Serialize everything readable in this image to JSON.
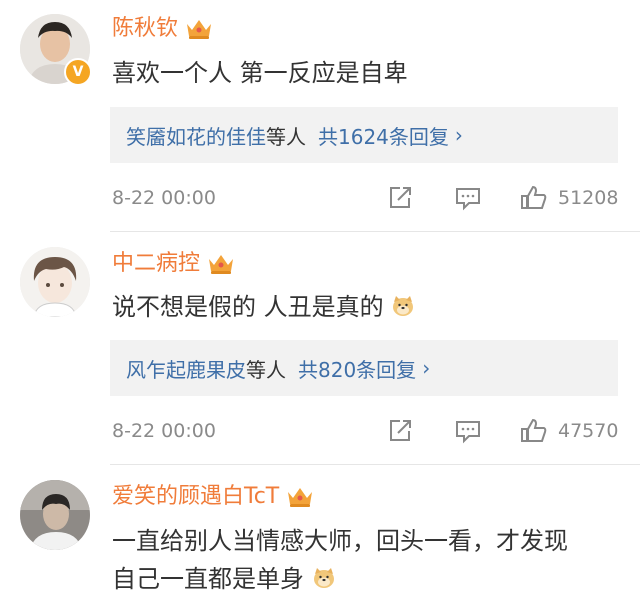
{
  "comments": [
    {
      "name": "陈秋钦",
      "verified_badge": "V",
      "text": "喜欢一个人 第一反应是自卑",
      "reply_names": "笑靥如花的佳佳",
      "reply_connector": "等人",
      "reply_total": "共1624条回复",
      "reply_chevron": "›",
      "time": "8-22 00:00",
      "likes": "51208"
    },
    {
      "name": "中二病控",
      "text": "说不想是假的 人丑是真的",
      "emoji": "doge-emoji",
      "reply_names": "风乍起鹿果皮",
      "reply_connector": "等人",
      "reply_total": "共820条回复",
      "reply_chevron": "›",
      "time": "8-22 00:00",
      "likes": "47570"
    },
    {
      "name": "爱笑的顾遇白TcT",
      "text_line1": "一直给别人当情感大师，回头一看，才发现",
      "text_line2": "自己一直都是单身",
      "emoji": "doge-emoji"
    }
  ],
  "icons": {
    "crown": "crown-icon",
    "share": "share-icon",
    "comment": "comment-icon",
    "like": "like-icon"
  },
  "colors": {
    "username": "#f07c3a",
    "link": "#3f6fa8",
    "reply_bg": "#f2f2f2",
    "muted": "#8a8a8a",
    "crown": "#f3a33a"
  }
}
